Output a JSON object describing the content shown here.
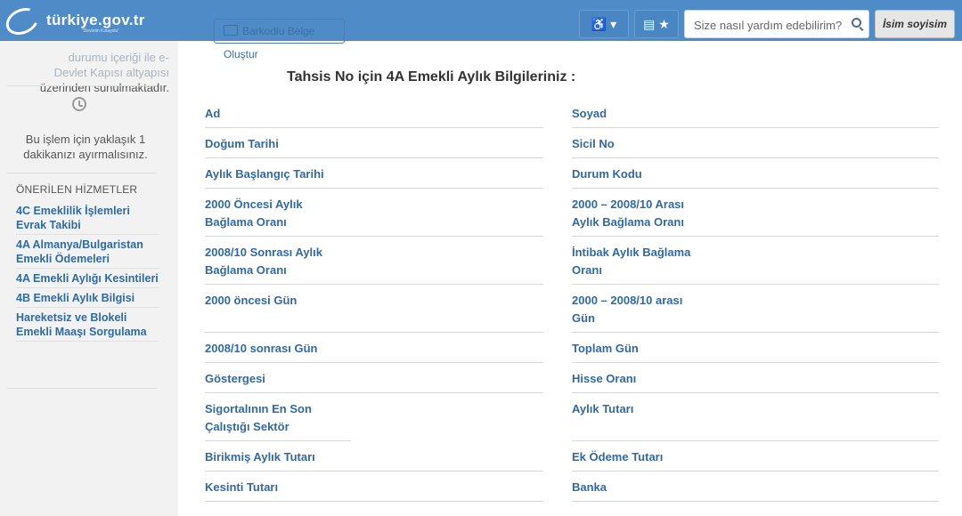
{
  "header": {
    "logo_text": "türkiye.gov.tr",
    "logo_sub": "“Devletin Kısayolu”",
    "ghost_button": "Barkodlu Belge Oluştur",
    "accessibility_label": "♿ ▾",
    "search_placeholder": "Size nasıl yardım edebilirim?",
    "user_name": "İsim soyisim"
  },
  "sidebar": {
    "intro_faded_1": "durumu içeriği ile e-",
    "intro_faded_2": "Devlet Kapısı altyapısı",
    "intro_line": "üzerinden sunulmaktadır.",
    "time_text": "Bu işlem için yaklaşık 1 dakikanızı ayırmalısınız.",
    "suggested_heading": "ÖNERİLEN HİZMETLER",
    "links": [
      "4C Emeklilik İşlemleri Evrak Takibi",
      "4A Almanya/Bulgaristan Emekli Ödemeleri",
      "4A Emekli Aylığı Kesintileri",
      "4B Emekli Aylık Bilgisi",
      "Hareketsiz ve Blokeli Emekli Maaşı Sorgulama"
    ]
  },
  "main": {
    "title": "Tahsis No için 4A Emekli Aylık Bilgileriniz :",
    "left_fields": [
      [
        "Ad"
      ],
      [
        "Doğum Tarihi"
      ],
      [
        "Aylık Başlangıç Tarihi"
      ],
      [
        "2000 Öncesi Aylık",
        "Bağlama Oranı"
      ],
      [
        "2008/10 Sonrası Aylık",
        "Bağlama Oranı"
      ],
      [
        "2000 öncesi Gün"
      ],
      [
        "2008/10 sonrası Gün"
      ],
      [
        "Göstergesi"
      ],
      [
        "Sigortalının En Son",
        "Çalıştığı Sektör"
      ],
      [
        "Birikmiş Aylık Tutarı"
      ],
      [
        "Kesinti Tutarı"
      ]
    ],
    "right_fields": [
      [
        "Soyad"
      ],
      [
        "Sicil No"
      ],
      [
        "Durum Kodu"
      ],
      [
        "2000 – 2008/10 Arası",
        "Aylık Bağlama Oranı"
      ],
      [
        "İntibak Aylık Bağlama",
        "Oranı"
      ],
      [
        "2000 – 2008/10 arası",
        "Gün"
      ],
      [
        "Toplam Gün"
      ],
      [
        "Hisse Oranı"
      ],
      [
        "Aylık Tutarı"
      ],
      [
        "Ek Ödeme Tutarı"
      ],
      [
        "Banka"
      ]
    ]
  }
}
